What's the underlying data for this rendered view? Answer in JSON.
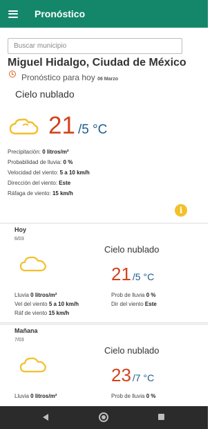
{
  "appbar": {
    "title": "Pronóstico",
    "icon": "menu-icon"
  },
  "search": {
    "placeholder": "Buscar municipio"
  },
  "location": "Miguel Hidalgo, Ciudad de México",
  "forecast": {
    "label": "Pronóstico para hoy",
    "date": "06 Marzo"
  },
  "today": {
    "condition": "Cielo nublado",
    "temp_max": "21",
    "temp_min": "/5 °C",
    "details": [
      {
        "label": "Precipitación:",
        "value": "0 litros/m²"
      },
      {
        "label": "Probabilidad de lluvia:",
        "value": "0 %"
      },
      {
        "label": "Velocidad del viento:",
        "value": "5 a 10 km/h"
      },
      {
        "label": "Dirección del viento:",
        "value": "Este"
      },
      {
        "label": "Ráfaga de viento:",
        "value": "15 km/h"
      }
    ]
  },
  "info_icon": "i",
  "days": [
    {
      "day": "Hoy",
      "date": "6/03",
      "condition": "Cielo nublado",
      "temp_max": "21",
      "temp_min": "/5 °C",
      "left": [
        {
          "label": "Lluvia",
          "value": "0 litros/m²"
        },
        {
          "label": "Vel del viento",
          "value": "5 a 10 km/h"
        },
        {
          "label": "Ráf de viento",
          "value": "15 km/h"
        }
      ],
      "right": [
        {
          "label": "Prob de lluvia",
          "value": "0 %"
        },
        {
          "label": "Dir del viento",
          "value": "Este"
        }
      ]
    },
    {
      "day": "Mañana",
      "date": "7/03",
      "condition": "Cielo nublado",
      "temp_max": "23",
      "temp_min": "/7 °C",
      "left": [
        {
          "label": "Lluvia",
          "value": "0 litros/m²"
        }
      ],
      "right": [
        {
          "label": "Prob de lluvia",
          "value": "0 %"
        }
      ]
    }
  ],
  "colors": {
    "appbar": "#14876b",
    "temp_max": "#d2431d",
    "temp_min": "#1f5b8b",
    "cloud": "#f2c02a",
    "clock": "#d9641e"
  }
}
